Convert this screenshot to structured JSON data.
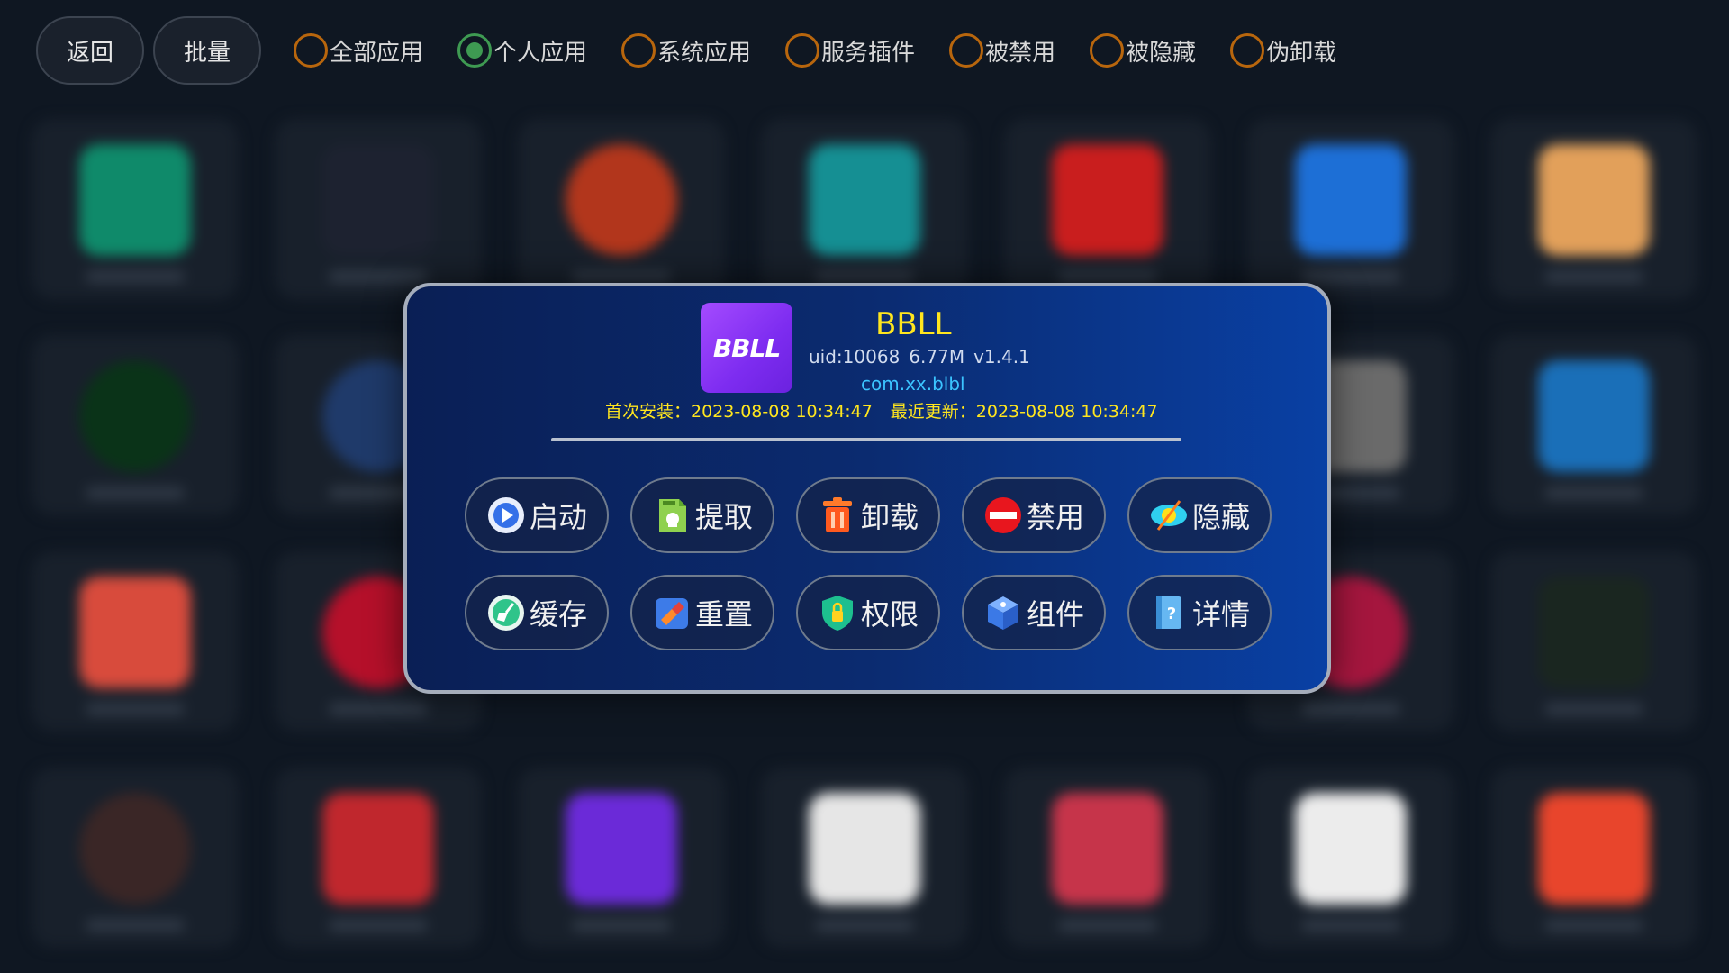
{
  "toolbar": {
    "back_label": "返回",
    "batch_label": "批量"
  },
  "filters": [
    {
      "label": "全部应用",
      "checked": false
    },
    {
      "label": "个人应用",
      "checked": true
    },
    {
      "label": "系统应用",
      "checked": false
    },
    {
      "label": "服务插件",
      "checked": false
    },
    {
      "label": "被禁用",
      "checked": false
    },
    {
      "label": "被隐藏",
      "checked": false
    },
    {
      "label": "伪卸载",
      "checked": false
    }
  ],
  "dialog": {
    "icon_text": "BBLL",
    "app_name": "BBLL",
    "uid": "uid:10068",
    "size": "6.77M",
    "version": "v1.4.1",
    "package": "com.xx.blbl",
    "first_install": "首次安装：2023-08-08 10:34:47",
    "last_update": "最近更新：2023-08-08 10:34:47",
    "actions": [
      {
        "label": "启动",
        "icon": "play-icon"
      },
      {
        "label": "提取",
        "icon": "apk-extract-icon"
      },
      {
        "label": "卸载",
        "icon": "trash-icon"
      },
      {
        "label": "禁用",
        "icon": "no-entry-icon"
      },
      {
        "label": "隐藏",
        "icon": "eye-hidden-icon"
      },
      {
        "label": "缓存",
        "icon": "broom-icon"
      },
      {
        "label": "重置",
        "icon": "reset-brush-icon"
      },
      {
        "label": "权限",
        "icon": "shield-lock-icon"
      },
      {
        "label": "组件",
        "icon": "component-box-icon"
      },
      {
        "label": "详情",
        "icon": "book-question-icon"
      }
    ]
  },
  "colors": {
    "accent_yellow": "#ffe61e",
    "package_blue": "#3bc4ff",
    "radio_unchecked": "#b8660d",
    "radio_checked": "#3e9a52"
  }
}
